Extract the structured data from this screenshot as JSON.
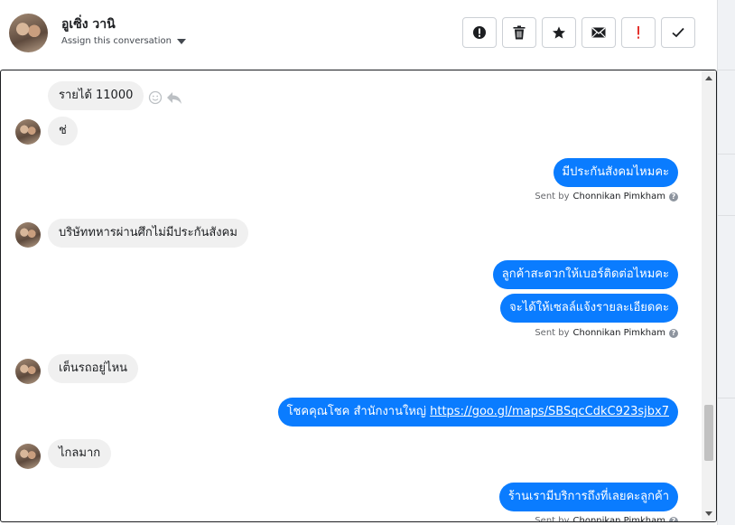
{
  "contact": {
    "name": "อูเซิ่ง วานิ",
    "assign_label": "Assign this conversation"
  },
  "toolbar": {
    "buttons": [
      {
        "icon": "alert-circle-icon",
        "name": "alert-button"
      },
      {
        "icon": "trash-icon",
        "name": "delete-button"
      },
      {
        "icon": "star-icon",
        "name": "star-button"
      },
      {
        "icon": "envelope-icon",
        "name": "mark-unread-button"
      },
      {
        "icon": "exclamation-icon",
        "name": "spam-button"
      },
      {
        "icon": "check-icon",
        "name": "done-button"
      }
    ]
  },
  "messages": [
    {
      "side": "in",
      "text": "รายได้ 11000"
    },
    {
      "side": "in",
      "text": "ช่"
    },
    {
      "side": "out",
      "text": "มีประกันสังคมไหมคะ"
    },
    {
      "side": "in",
      "text": "บริษัททหารผ่านศึกไม่มีประกันสังคม"
    },
    {
      "side": "out",
      "text": "ลูกค้าสะดวกให้เบอร์ติดต่อไหมคะ"
    },
    {
      "side": "out",
      "text": "จะได้ให้เซลล์แจ้งรายละเอียดคะ"
    },
    {
      "side": "in",
      "text": "เต็นรถอยู่ไหน"
    },
    {
      "side": "out",
      "text": "โชคคุณโชค สำนักงานใหญ่ ",
      "link": "https://goo.gl/maps/SBSqcCdkC923sjbx7"
    },
    {
      "side": "in",
      "text": "ไกลมาก"
    },
    {
      "side": "out",
      "text": "ร้านเรามีบริการถึงที่เลยคะลูกค้า"
    }
  ],
  "sent_by": {
    "prefix": "Sent by",
    "agent": "Chonnikan Pimkham",
    "help": "?"
  },
  "colors": {
    "outgoing_bubble": "#0a7cff",
    "incoming_bubble": "#f0f0f0",
    "spam_icon": "#e4322d"
  }
}
